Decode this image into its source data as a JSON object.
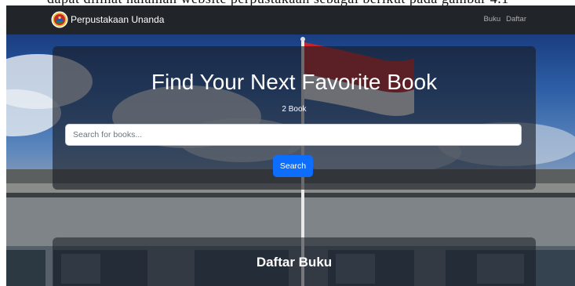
{
  "top_clip_text": "dapat dilihat halaman website perpustakaan sebagai berikut pada gambar 4.1",
  "navbar": {
    "brand_label": "Perpustakaan Unanda",
    "links": [
      {
        "label": "Buku"
      },
      {
        "label": "Daftar"
      }
    ]
  },
  "hero": {
    "headline": "Find Your Next Favorite Book",
    "book_count": "2 Book",
    "search": {
      "placeholder": "Search for books...",
      "value": "",
      "button_label": "Search"
    }
  },
  "book_list": {
    "title": "Daftar Buku"
  },
  "colors": {
    "navbar_bg": "#212529",
    "primary_button": "#0d6efd",
    "flag_red": "#c8252c",
    "flag_white": "#f4f4f4"
  },
  "icons": {
    "brand_logo": "university-emblem-icon"
  }
}
